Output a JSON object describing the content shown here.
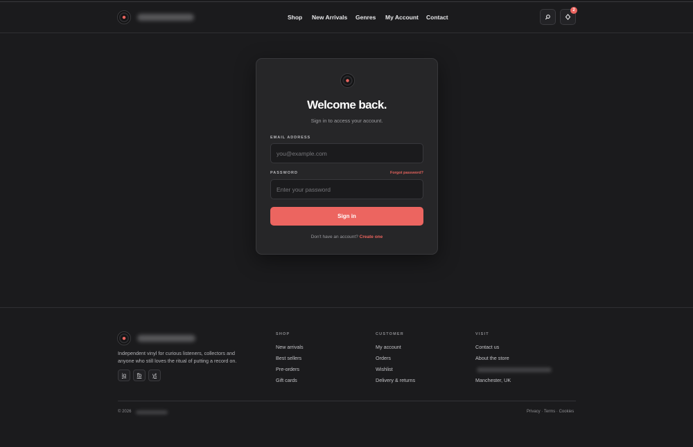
{
  "header": {
    "nav": [
      {
        "label": "Shop"
      },
      {
        "label": "New Arrivals"
      },
      {
        "label": "Genres"
      },
      {
        "label": "My Account"
      },
      {
        "label": "Contact"
      }
    ],
    "search_icon": "search-icon",
    "cart_icon": "cart-icon",
    "cart_count": "2"
  },
  "login": {
    "title": "Welcome back.",
    "subtitle": "Sign in to access your account.",
    "email_label": "EMAIL ADDRESS",
    "email_placeholder": "you@example.com",
    "email_value": "",
    "password_label": "PASSWORD",
    "forgot_label": "Forgot password?",
    "password_placeholder": "Enter your password",
    "password_value": "",
    "submit_label": "Sign in",
    "no_account_text": "Don't have an account?",
    "create_label": "Create one"
  },
  "footer": {
    "tagline": "Independent vinyl for curious listeners, collectors and anyone who still loves the ritual of putting a record on.",
    "social": [
      "ig",
      "fb",
      "yt"
    ],
    "columns": [
      {
        "heading": "SHOP",
        "links": [
          "New arrivals",
          "Best sellers",
          "Pre-orders",
          "Gift cards"
        ]
      },
      {
        "heading": "CUSTOMER",
        "links": [
          "My account",
          "Orders",
          "Wishlist",
          "Delivery & returns"
        ]
      },
      {
        "heading": "VISIT",
        "links": [
          "Contact us",
          "About the store",
          "Manchester, UK"
        ]
      }
    ],
    "copyright": "© 2026",
    "legal": {
      "privacy": "Privacy",
      "terms": "Terms",
      "cookies": "Cookies",
      "separator": "·"
    }
  },
  "colors": {
    "accent": "#ec6560",
    "background": "#1b1b1d",
    "card": "#262628"
  }
}
